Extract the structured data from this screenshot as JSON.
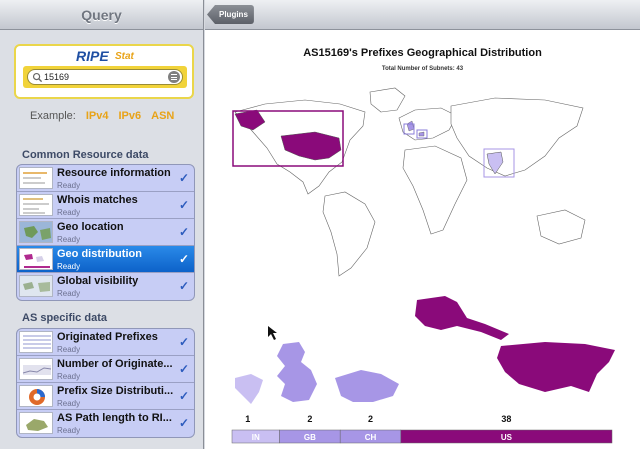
{
  "left_panel": {
    "title": "Query",
    "logo": {
      "ripe": "RIPE",
      "stat": "Stat"
    },
    "search": {
      "value": "15169",
      "placeholder": ""
    },
    "example": {
      "label": "Example:",
      "links": [
        "IPv4",
        "IPv6",
        "ASN"
      ]
    },
    "sections": [
      {
        "title": "Common Resource data",
        "items": [
          {
            "title": "Resource information",
            "status": "Ready",
            "selected": false
          },
          {
            "title": "Whois matches",
            "status": "Ready",
            "selected": false
          },
          {
            "title": "Geo location",
            "status": "Ready",
            "selected": false
          },
          {
            "title": "Geo distribution",
            "status": "Ready",
            "selected": true
          },
          {
            "title": "Global visibility",
            "status": "Ready",
            "selected": false
          }
        ]
      },
      {
        "title": "AS specific data",
        "items": [
          {
            "title": "Originated Prefixes",
            "status": "Ready",
            "selected": false
          },
          {
            "title": "Number of Originate...",
            "status": "Ready",
            "selected": false
          },
          {
            "title": "Prefix Size Distributi...",
            "status": "Ready",
            "selected": false
          },
          {
            "title": "AS Path length to RI...",
            "status": "Ready",
            "selected": false
          }
        ]
      }
    ]
  },
  "right_panel": {
    "back_button": "Plugins",
    "chart_title": "AS15169's Prefixes Geographical Distribution",
    "chart_subtitle": "Total Number of Subnets: 43"
  },
  "colors": {
    "selected_row": "#1a75dc",
    "row_bg": "#c7cdf5",
    "accent_orange": "#e8a318",
    "us_purple": "#8a0a7a",
    "europe_lavender": "#a796e6"
  },
  "chart_data": {
    "type": "bar",
    "categories": [
      "IN",
      "GB",
      "CH",
      "US"
    ],
    "values": [
      1,
      2,
      2,
      38
    ],
    "stacked_horizontal": true,
    "total": 43
  }
}
